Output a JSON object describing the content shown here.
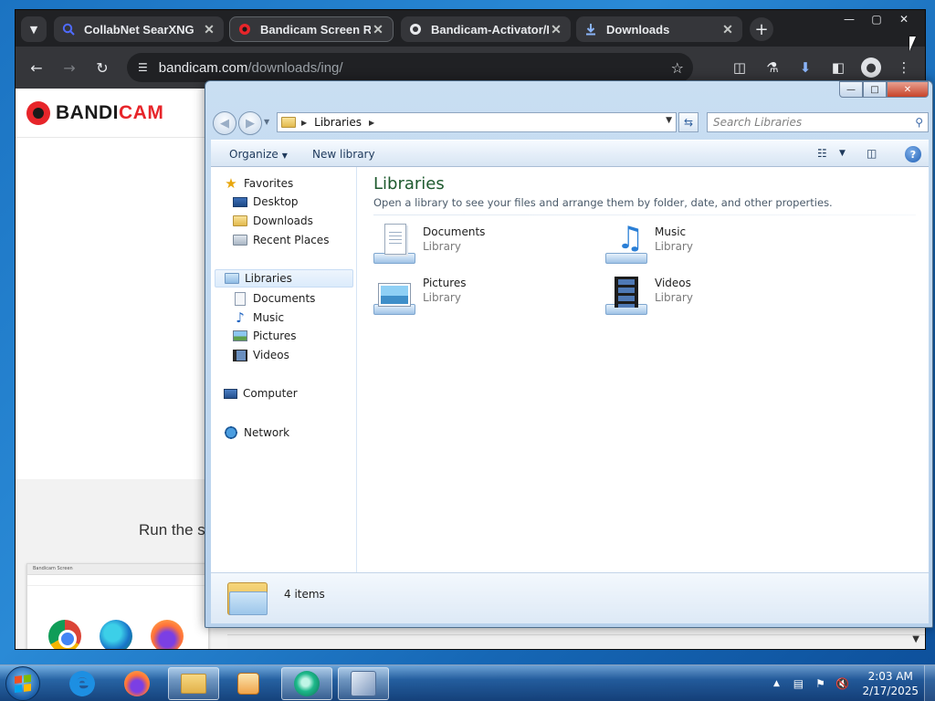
{
  "browser": {
    "tabs": [
      {
        "title": "CollabNet SearXNG",
        "icon": "search-icon"
      },
      {
        "title": "Bandicam Screen Recorder",
        "icon": "bandicam-icon"
      },
      {
        "title": "Bandicam-Activator/Bandicam",
        "icon": "github-icon"
      },
      {
        "title": "Downloads",
        "icon": "download-icon"
      }
    ],
    "url_host": "bandicam.com",
    "url_path": "/downloads/ing/",
    "page": {
      "logo_left": "BANDI",
      "logo_right": "CAM",
      "run_text": "Run the s",
      "mini_tab": "Bandicam Screen"
    }
  },
  "explorer": {
    "breadcrumb": "Libraries",
    "search_placeholder": "Search Libraries",
    "commands": {
      "organize": "Organize",
      "new_library": "New library"
    },
    "nav": {
      "favorites": "Favorites",
      "favorites_items": [
        "Desktop",
        "Downloads",
        "Recent Places"
      ],
      "libraries": "Libraries",
      "library_items": [
        "Documents",
        "Music",
        "Pictures",
        "Videos"
      ],
      "computer": "Computer",
      "network": "Network"
    },
    "content": {
      "title": "Libraries",
      "subtitle": "Open a library to see your files and arrange them by folder, date, and other properties.",
      "items": [
        {
          "name": "Documents",
          "type": "Library"
        },
        {
          "name": "Music",
          "type": "Library"
        },
        {
          "name": "Pictures",
          "type": "Library"
        },
        {
          "name": "Videos",
          "type": "Library"
        }
      ]
    },
    "details": {
      "count": "4 items"
    }
  },
  "taskbar": {
    "clock_time": "2:03 AM",
    "clock_date": "2/17/2025"
  },
  "colors": {
    "chrome_dark": "#202124",
    "chrome_tab": "#35363a",
    "bandicam_red": "#e7252a",
    "explorer_title_green": "#1e5a2e",
    "win7_frame": "#b7d1ec"
  }
}
